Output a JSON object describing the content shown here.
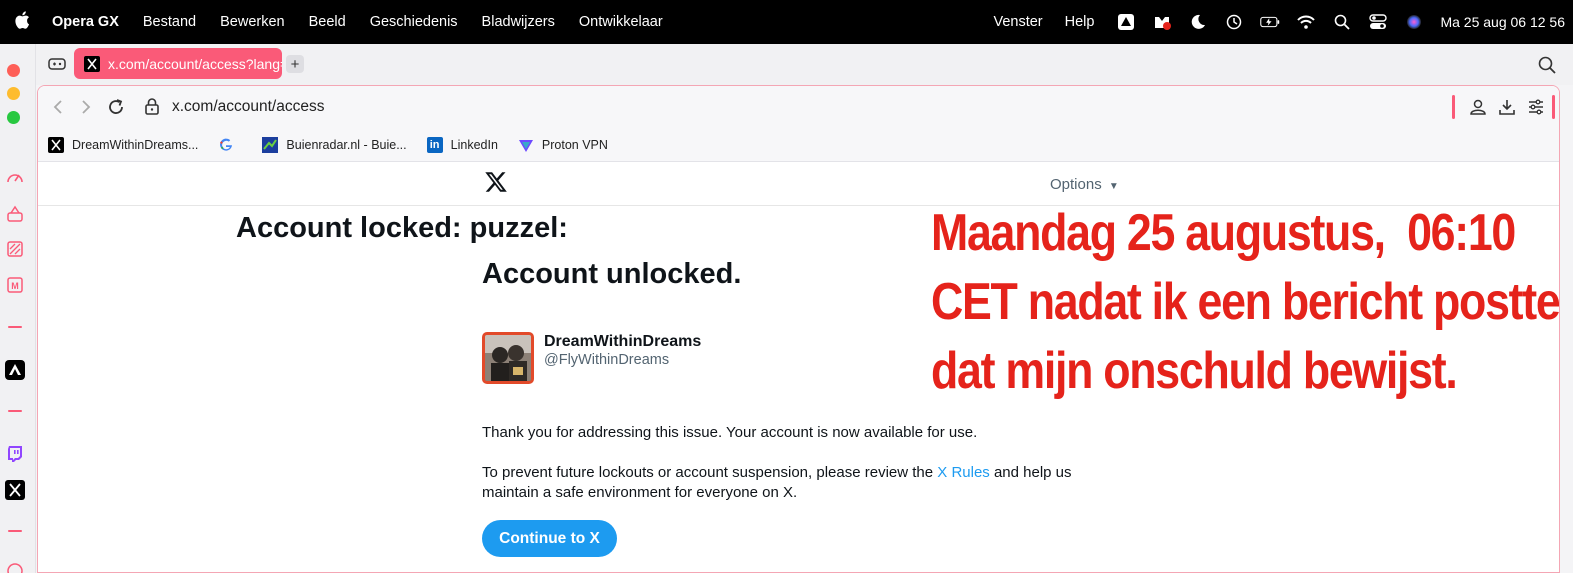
{
  "menubar": {
    "app_name": "Opera GX",
    "items": [
      "Bestand",
      "Bewerken",
      "Beeld",
      "Geschiedenis",
      "Bladwijzers",
      "Ontwikkelaar"
    ],
    "right_items": [
      "Venster",
      "Help"
    ],
    "clock": "Ma 25 aug  06 12 56"
  },
  "tab": {
    "title": "x.com/account/access?lang=nl",
    "new_tab_label": "+"
  },
  "address_bar": {
    "url": "x.com/account/access"
  },
  "bookmarks": [
    {
      "label": "DreamWithinDreams...",
      "icon": "x-favicon-icon"
    },
    {
      "label": "",
      "icon": "google-favicon-icon"
    },
    {
      "label": "Buienradar.nl - Buie...",
      "icon": "buienradar-favicon-icon"
    },
    {
      "label": "LinkedIn",
      "icon": "linkedin-favicon-icon"
    },
    {
      "label": "Proton VPN",
      "icon": "proton-vpn-favicon-icon"
    }
  ],
  "page": {
    "options_label": "Options",
    "locked_title": "Account locked: puzzel:",
    "unlocked_title": "Account unlocked.",
    "user": {
      "display_name": "DreamWithinDreams",
      "handle": "@FlyWithinDreams"
    },
    "para1": "Thank you for addressing this issue. Your account is now available for use.",
    "para2_before": "To prevent future lockouts or account suspension, please review the ",
    "para2_link": "X Rules",
    "para2_after": " and help us maintain a safe environment for everyone on X.",
    "continue_label": "Continue to X"
  },
  "annotation": {
    "lines": [
      "Maandag 25 augustus,  06:10",
      "CET nadat ik een bericht postte",
      "dat mijn onschuld bewijst."
    ],
    "color": "#e5231b"
  },
  "colors": {
    "accent_pink": "#fa5a78",
    "x_blue": "#1d9bf0"
  }
}
